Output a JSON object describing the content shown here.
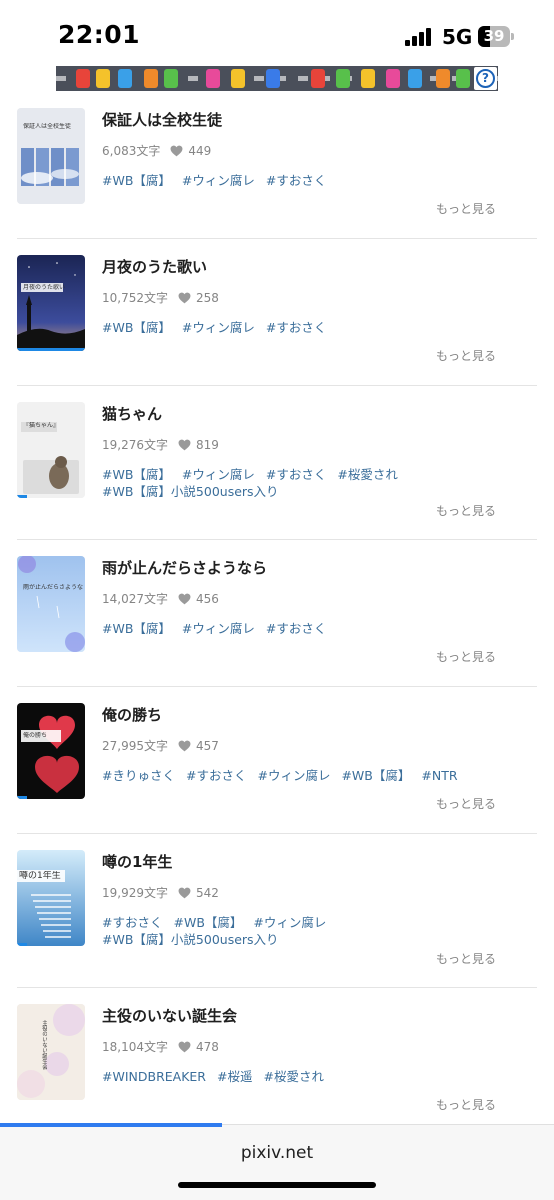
{
  "status_bar": {
    "time": "22:01",
    "network": "5G",
    "battery_percent": "39",
    "battery_level": 0.39
  },
  "ad_banner": {
    "help_icon": "question-mark-icon"
  },
  "novels": [
    {
      "title": "保証人は全校生徒",
      "chars": "6,083文字",
      "likes": "449",
      "tags": [
        "#WB【腐】",
        "#ウィン腐レ",
        "#すおさく"
      ],
      "more": "もっと見る",
      "cover_caption": "保証人は全校生徒",
      "cover_style": "clouds",
      "read_progress": 0
    },
    {
      "title": "月夜のうた歌い",
      "chars": "10,752文字",
      "likes": "258",
      "tags": [
        "#WB【腐】",
        "#ウィン腐レ",
        "#すおさく"
      ],
      "more": "もっと見る",
      "cover_caption": "月夜のうた歌い",
      "cover_style": "night",
      "read_progress": 1
    },
    {
      "title": "猫ちゃん",
      "chars": "19,276文字",
      "likes": "819",
      "tags": [
        "#WB【腐】",
        "#ウィン腐レ",
        "#すおさく",
        "#桜愛され",
        "#WB【腐】小説500users入り"
      ],
      "more": "もっと見る",
      "cover_caption": "『猫ちゃん』",
      "cover_style": "cat",
      "read_progress": 0.15
    },
    {
      "title": "雨が止んだらさようなら",
      "chars": "14,027文字",
      "likes": "456",
      "tags": [
        "#WB【腐】",
        "#ウィン腐レ",
        "#すおさく"
      ],
      "more": "もっと見る",
      "cover_caption": "雨が止んだらさようなら",
      "cover_style": "rain",
      "read_progress": 0
    },
    {
      "title": "俺の勝ち",
      "chars": "27,995文字",
      "likes": "457",
      "tags": [
        "#きりゅさく",
        "#すおさく",
        "#ウィン腐レ",
        "#WB【腐】",
        "#NTR"
      ],
      "more": "もっと見る",
      "cover_caption": "俺の勝ち",
      "cover_style": "hearts",
      "read_progress": 0.15
    },
    {
      "title": "噂の1年生",
      "chars": "19,929文字",
      "likes": "542",
      "tags": [
        "#すおさく",
        "#WB【腐】",
        "#ウィン腐レ",
        "#WB【腐】小説500users入り"
      ],
      "more": "もっと見る",
      "cover_caption": "噂の1年生",
      "cover_style": "stairs",
      "read_progress": 0.15
    },
    {
      "title": "主役のいない誕生会",
      "chars": "18,104文字",
      "likes": "478",
      "tags": [
        "#WINDBREAKER",
        "#桜遥",
        "#桜愛され"
      ],
      "more": "もっと見る",
      "cover_caption": "主役のいない誕生会",
      "cover_style": "blossom",
      "read_progress": 0
    }
  ],
  "bottom_bar": {
    "url": "pixiv.net",
    "load_progress": 0.4
  },
  "colors": {
    "tag": "#3b6e9a",
    "meta": "#858585",
    "progress": "#1e88e5"
  }
}
